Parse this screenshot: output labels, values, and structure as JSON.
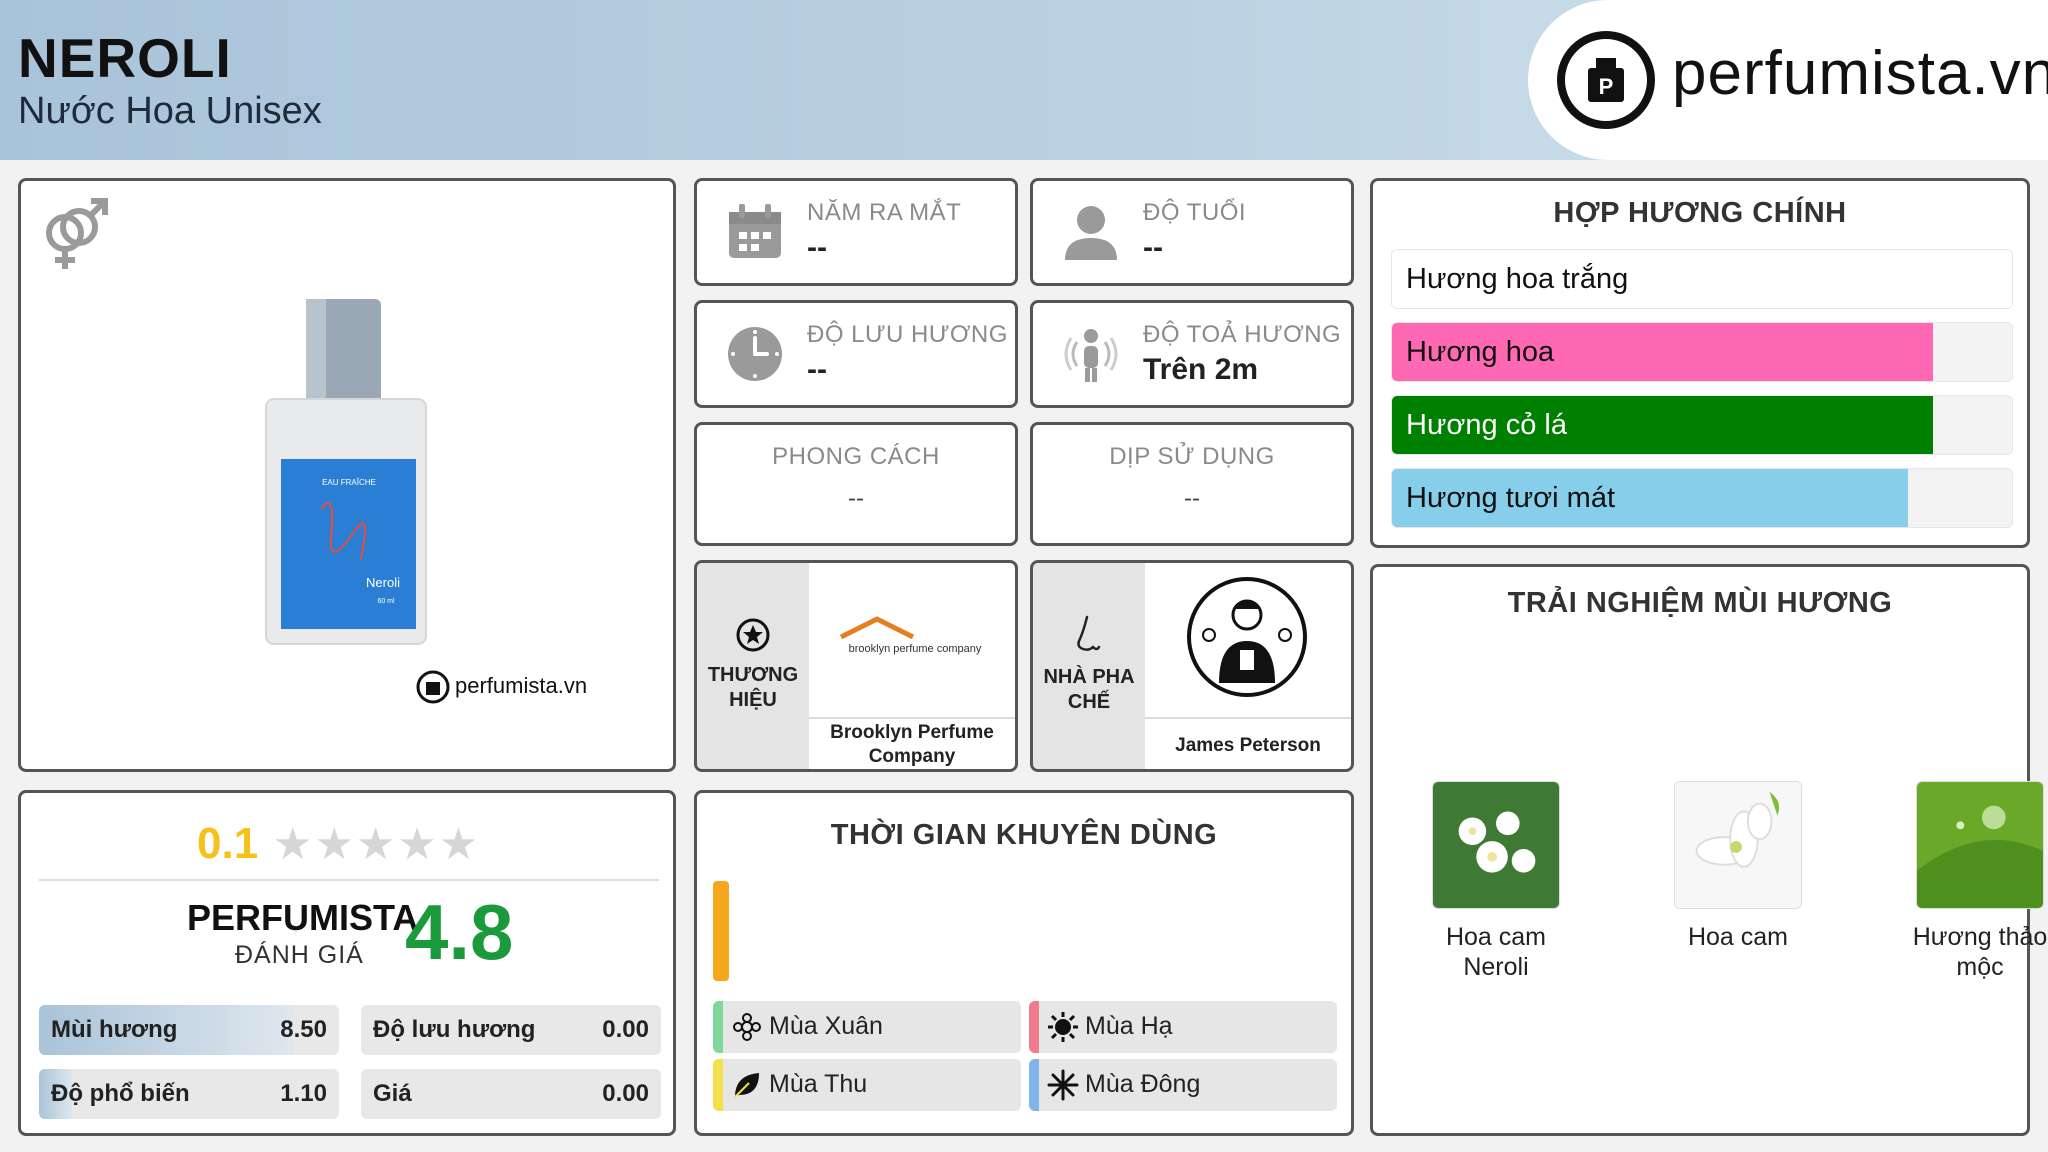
{
  "header": {
    "title": "NEROLI",
    "subtitle": "Nước Hoa Unisex",
    "logo_text": "perfumista.vn"
  },
  "product_image": {
    "bottle_brand_text": "EAU FRAÎCHE",
    "bottle_name": "Neroli",
    "bottle_volume": "60 ml",
    "watermark": "perfumista.vn"
  },
  "info": {
    "release_year": {
      "label": "NĂM RA MẮT",
      "value": "--"
    },
    "age": {
      "label": "ĐỘ TUỔI",
      "value": "--"
    },
    "longevity": {
      "label": "ĐỘ LƯU HƯƠNG",
      "value": "--"
    },
    "sillage": {
      "label": "ĐỘ TOẢ HƯƠNG",
      "value": "Trên 2m"
    },
    "style": {
      "label": "PHONG CÁCH",
      "value": "--"
    },
    "occasion": {
      "label": "DỊP SỬ DỤNG",
      "value": "--"
    }
  },
  "brand": {
    "label_line1": "THƯƠNG",
    "label_line2": "HIỆU",
    "logo_text": "brooklyn perfume company",
    "name_line1": "Brooklyn Perfume",
    "name_line2": "Company"
  },
  "perfumer": {
    "label_line1": "NHÀ PHA",
    "label_line2": "CHẾ",
    "name": "James Peterson"
  },
  "accords": {
    "title": "HỢP HƯƠNG CHÍNH",
    "items": [
      {
        "label": "Hương hoa trắng",
        "level": 1.0,
        "color": "#ffffff"
      },
      {
        "label": "Hương hoa",
        "level": 0.87,
        "color": "#ff69b4"
      },
      {
        "label": "Hương cỏ lá",
        "level": 0.87,
        "color": "#008000"
      },
      {
        "label": "Hương tươi mát",
        "level": 0.83,
        "color": "#87ceeb"
      }
    ]
  },
  "rating": {
    "user_score": "0.1",
    "stars_filled": 0.02,
    "brand": "PERFUMISTA",
    "label": "ĐÁNH GIÁ",
    "score": "4.8",
    "score_color": "#1a9a3a",
    "metrics": [
      {
        "label": "Mùi hương",
        "value": "8.50",
        "level": 0.85
      },
      {
        "label": "Độ lưu hương",
        "value": "0.00",
        "level": 0
      },
      {
        "label": "Độ phổ biến",
        "value": "1.10",
        "level": 0.11
      },
      {
        "label": "Giá",
        "value": "0.00",
        "level": 0
      }
    ]
  },
  "time": {
    "title": "THỜI GIAN KHUYÊN DÙNG",
    "seasons": [
      {
        "label": "Mùa Xuân",
        "color": "#7ed99a",
        "icon": "flower-icon"
      },
      {
        "label": "Mùa Hạ",
        "color": "#f07b8a",
        "icon": "sun-icon"
      },
      {
        "label": "Mùa Thu",
        "color": "#f4e04d",
        "icon": "leaf-icon"
      },
      {
        "label": "Mùa Đông",
        "color": "#7fb5e8",
        "icon": "snowflake-icon"
      }
    ]
  },
  "experience": {
    "title": "TRẢI NGHIỆM MÙI HƯƠNG",
    "notes": [
      {
        "line1": "Hoa cam",
        "line2": "Neroli"
      },
      {
        "line1": "Hoa cam",
        "line2": ""
      },
      {
        "line1": "Hương thảo",
        "line2": "mộc"
      }
    ]
  }
}
